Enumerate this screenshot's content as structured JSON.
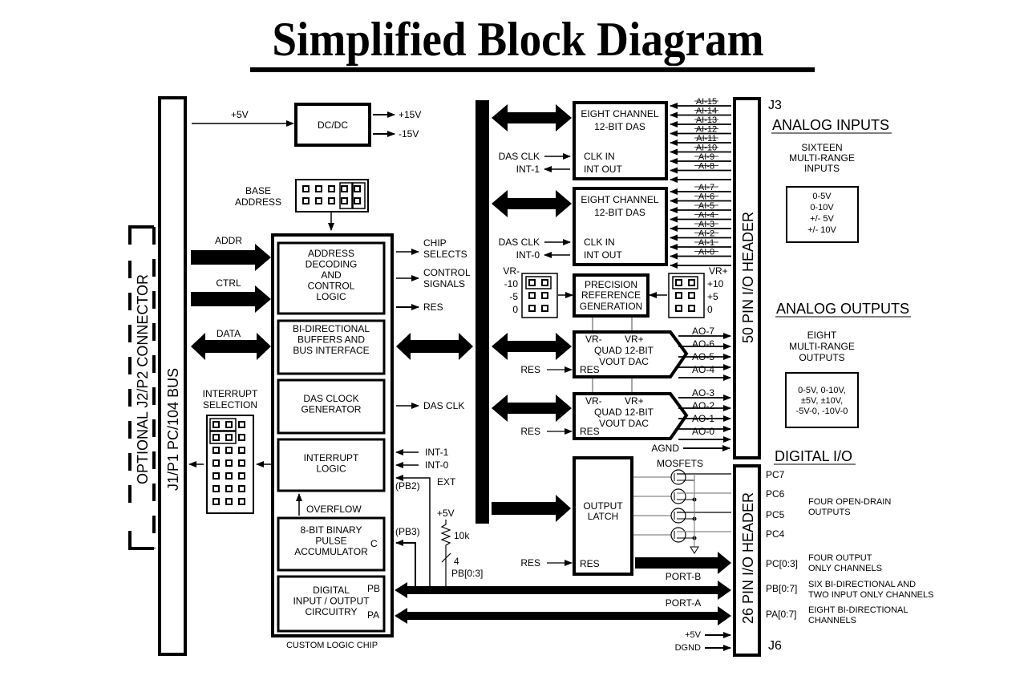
{
  "title": "Simplified Block Diagram",
  "left": {
    "optional_connector": "OPTIONAL  J2/P2 CONNECTOR",
    "bus": "J1/P1   PC/104 BUS",
    "addr": "ADDR",
    "ctrl": "CTRL",
    "data": "DATA",
    "interrupt_selection": [
      "INTERRUPT",
      "SELECTION"
    ]
  },
  "power": {
    "input": "+5V",
    "dcdc": "DC/DC",
    "out_pos": "+15V",
    "out_neg": "-15V"
  },
  "base_address": [
    "BASE",
    "ADDRESS"
  ],
  "chip": {
    "caption": "CUSTOM LOGIC CHIP",
    "blocks": [
      {
        "lines": [
          "ADDRESS",
          "DECODING",
          "AND",
          "CONTROL",
          "LOGIC"
        ]
      },
      {
        "lines": [
          "BI-DIRECTIONAL",
          "BUFFERS AND",
          "BUS INTERFACE"
        ]
      },
      {
        "lines": [
          "DAS CLOCK",
          "GENERATOR"
        ]
      },
      {
        "lines": [
          "INTERRUPT",
          "LOGIC"
        ]
      },
      {
        "lines": [
          "8-BIT BINARY",
          "PULSE",
          "ACCUMULATOR"
        ],
        "side": "C"
      },
      {
        "lines": [
          "DIGITAL",
          "INPUT / OUTPUT",
          "CIRCUITRY"
        ],
        "side_top": "PB",
        "side_bottom": "PA"
      }
    ],
    "overflow": "OVERFLOW",
    "outputs": {
      "chip_selects": [
        "CHIP",
        "SELECTS"
      ],
      "control_signals": [
        "CONTROL",
        "SIGNALS"
      ],
      "res": "RES",
      "das_clk": "DAS CLK",
      "int1": "INT-1",
      "int0": "INT-0",
      "ext": "EXT",
      "pb2": "(PB2)",
      "pb3": "(PB3)",
      "plus5v": "+5V",
      "resistor": "10k",
      "bus_width": "4",
      "pb03": "PB[0:3]"
    }
  },
  "das": [
    {
      "title": [
        "EIGHT CHANNEL",
        "12-BIT DAS"
      ],
      "clk_in": "CLK  IN",
      "int_out": "INT  OUT",
      "clk_label": "DAS CLK",
      "int_label": "INT-1",
      "inputs": [
        "AI-15",
        "AI-14",
        "AI-13",
        "AI-12",
        "AI-11",
        "AI-10",
        "AI-9",
        "AI-8"
      ]
    },
    {
      "title": [
        "EIGHT CHANNEL",
        "12-BIT DAS"
      ],
      "clk_in": "CLK  IN",
      "int_out": "INT  OUT",
      "clk_label": "DAS CLK",
      "int_label": "INT-0",
      "inputs": [
        "AI-7",
        "AI-6",
        "AI-5",
        "AI-4",
        "AI-3",
        "AI-2",
        "AI-1",
        "AI-0"
      ]
    }
  ],
  "reference": {
    "lines": [
      "PRECISION",
      "REFERENCE",
      "GENERATION"
    ],
    "vr_minus": "VR-",
    "vr_minus_opts": [
      "-10",
      "-5",
      "0"
    ],
    "vr_plus": "VR+",
    "vr_plus_opts": [
      "+10",
      "+5",
      "0"
    ]
  },
  "dac": [
    {
      "vrm": "VR-",
      "vrp": "VR+",
      "lines": [
        "QUAD 12-BIT",
        "VOUT DAC"
      ],
      "res": "RES",
      "res_in": "RES",
      "outputs": [
        "AO-7",
        "AO-6",
        "AO-5",
        "AO-4"
      ]
    },
    {
      "vrm": "VR-",
      "vrp": "VR+",
      "lines": [
        "QUAD 12-BIT",
        "VOUT DAC"
      ],
      "res": "RES",
      "res_in": "RES",
      "outputs": [
        "AO-3",
        "AO-2",
        "AO-1",
        "AO-0"
      ]
    }
  ],
  "agnd": "AGND",
  "latch": {
    "lines": [
      "OUTPUT",
      "LATCH"
    ],
    "res": "RES",
    "res_in": "RES",
    "mosfets": "MOSFETS"
  },
  "ports": {
    "port_b": "PORT-B",
    "port_a": "PORT-A",
    "plus5v": "+5V",
    "dgnd": "DGND"
  },
  "headers": {
    "j3": "J3",
    "j3_name": "50 PIN I/O HEADER",
    "j6": "J6",
    "j6_name": "26 PIN I/O HEADER"
  },
  "right": {
    "analog_inputs": {
      "heading": "ANALOG INPUTS",
      "desc": [
        "SIXTEEN",
        "MULTI-RANGE",
        "INPUTS"
      ],
      "ranges": [
        "0-5V",
        "0-10V",
        "+/- 5V",
        "+/- 10V"
      ]
    },
    "analog_outputs": {
      "heading": "ANALOG OUTPUTS",
      "desc": [
        "EIGHT",
        "MULTI-RANGE",
        "OUTPUTS"
      ],
      "ranges": [
        "0-5V,  0-10V,",
        "±5V,  ±10V,",
        "-5V-0,  -10V-0"
      ]
    },
    "digital_io": {
      "heading": "DIGITAL I/O",
      "pins": [
        "PC7",
        "PC6",
        "PC5",
        "PC4",
        "PC[0:3]",
        "PB[0:7]",
        "PA[0:7]"
      ],
      "open_drain": [
        "FOUR OPEN-DRAIN",
        "OUTPUTS"
      ],
      "pc03_desc": [
        "FOUR OUTPUT",
        "ONLY CHANNELS"
      ],
      "pb07_desc": [
        "SIX BI-DIRECTIONAL AND",
        "TWO INPUT ONLY CHANNELS"
      ],
      "pa07_desc": [
        "EIGHT BI-DIRECTIONAL",
        "CHANNELS"
      ]
    }
  }
}
